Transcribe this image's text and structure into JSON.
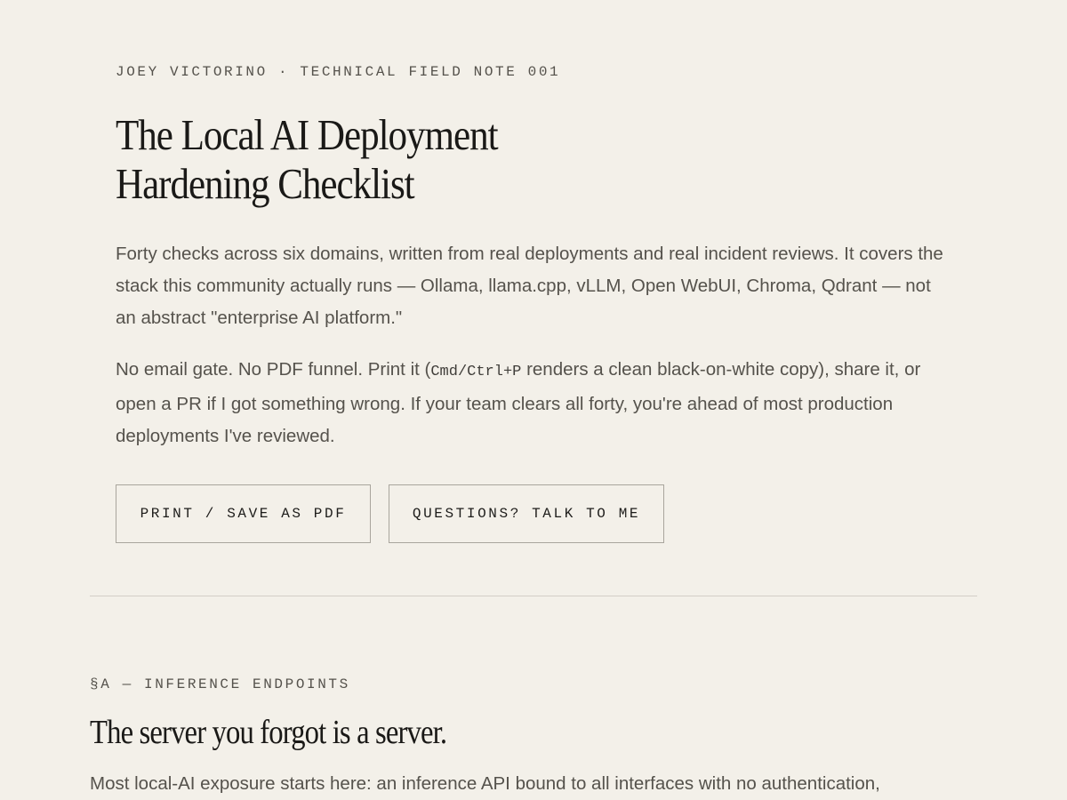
{
  "header": {
    "eyebrow": "JOEY VICTORINO · TECHNICAL FIELD NOTE 001",
    "title_line1": "The Local AI Deployment",
    "title_line2": "Hardening Checklist"
  },
  "intro": {
    "paragraph1": "Forty checks across six domains, written from real deployments and real incident reviews. It covers the stack this community actually runs — Ollama, llama.cpp, vLLM, Open WebUI, Chroma, Qdrant — not an abstract \"enterprise AI platform.\"",
    "paragraph2_before_code": "No email gate. No PDF funnel. Print it (",
    "paragraph2_code": "Cmd/Ctrl+P",
    "paragraph2_after_code": " renders a clean black-on-white copy), share it, or open a PR if I got something wrong. If your team clears all forty, you're ahead of most production deployments I've reviewed."
  },
  "actions": {
    "print_label": "PRINT / SAVE AS PDF",
    "talk_label": "QUESTIONS? TALK TO ME"
  },
  "section_a": {
    "eyebrow": "§A — INFERENCE ENDPOINTS",
    "title": "The server you forgot is a server.",
    "body": "Most local-AI exposure starts here: an inference API bound to all interfaces with no authentication,"
  }
}
